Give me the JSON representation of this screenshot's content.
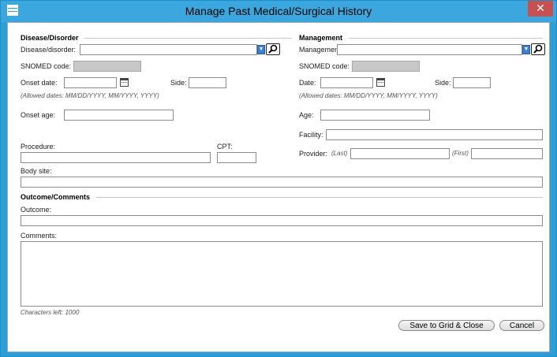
{
  "window": {
    "title": "Manage Past Medical/Surgical History",
    "close_glyph": "✕"
  },
  "disease": {
    "section": "Disease/Disorder",
    "disease_label": "Disease/disorder:",
    "disease_value": "",
    "snomed_label": "SNOMED code:",
    "snomed_value": "",
    "onset_date_label": "Onset date:",
    "side_label": "Side:",
    "allowed_dates": "(Allowed dates: MM/DD/YYYY, MM/YYYY, YYYY)",
    "onset_age_label": "Onset age:",
    "procedure_label": "Procedure:",
    "cpt_label": "CPT:",
    "body_site_label": "Body site:"
  },
  "management": {
    "section": "Management",
    "management_label": "Management:",
    "snomed_label": "SNOMED code:",
    "date_label": "Date:",
    "side_label": "Side:",
    "allowed_dates": "(Allowed dates: MM/DD/YYYY, MM/YYYY, YYYY)",
    "age_label": "Age:",
    "facility_label": "Facility:",
    "provider_label": "Provider:",
    "last_hint": "(Last)",
    "first_hint": "(First)"
  },
  "outcome": {
    "section": "Outcome/Comments",
    "outcome_label": "Outcome:",
    "comments_label": "Comments:",
    "chars_left": "Characters left: 1000"
  },
  "buttons": {
    "save": "Save to Grid & Close",
    "cancel": "Cancel"
  }
}
